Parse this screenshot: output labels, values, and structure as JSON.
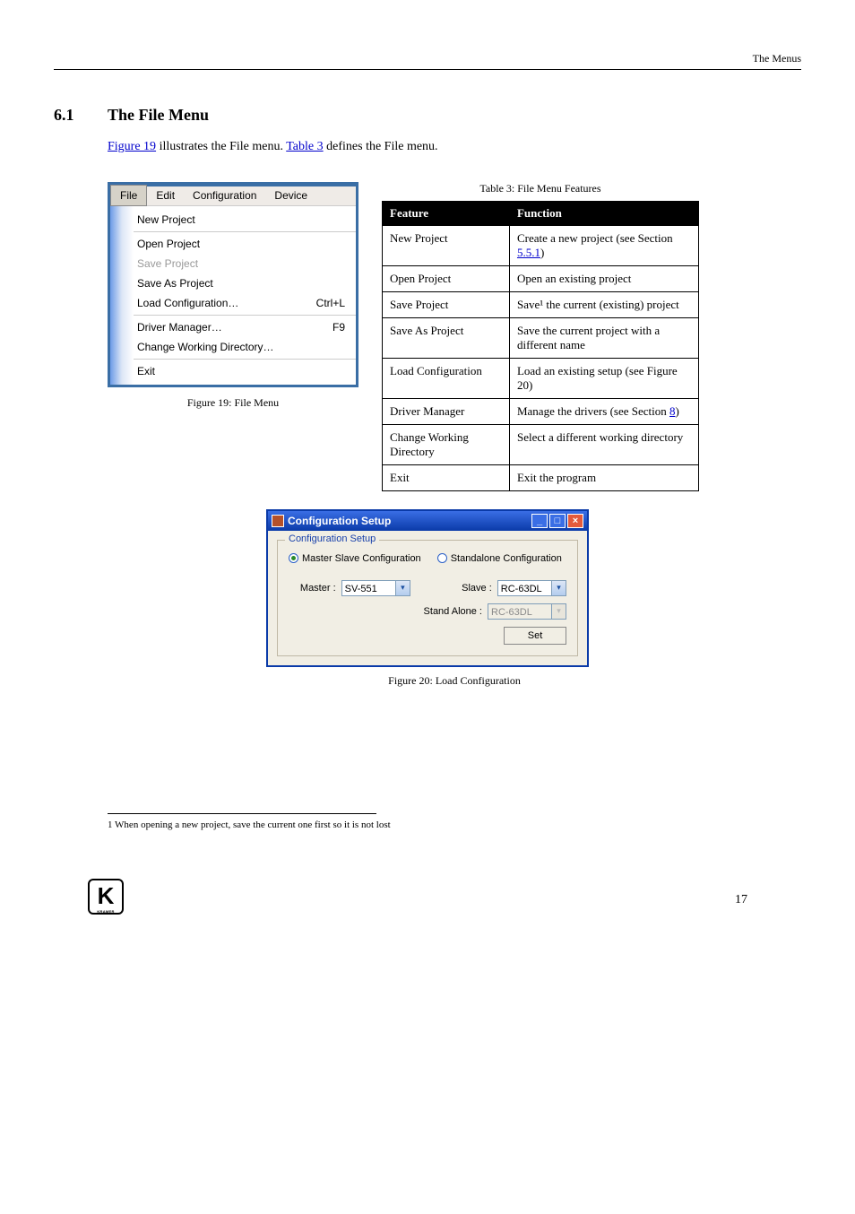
{
  "header": {
    "right": "The Menus"
  },
  "section": {
    "number": "6.1",
    "title": "The File Menu"
  },
  "para": {
    "link1": "Figure 19",
    "text1": " illustrates the File menu. ",
    "link2": "Table 3",
    "text2": " defines the File menu.",
    "caption_left": "Figure 19: File Menu",
    "caption_right": "Table 3: File Menu Features"
  },
  "filemenu": {
    "menubar": [
      "File",
      "Edit",
      "Configuration",
      "Device"
    ],
    "items": [
      {
        "label": "New Project",
        "shortcut": "",
        "disabled": false
      },
      {
        "label": "Open Project",
        "shortcut": "",
        "disabled": false
      },
      {
        "label": "Save Project",
        "shortcut": "",
        "disabled": true
      },
      {
        "label": "Save As Project",
        "shortcut": "",
        "disabled": false
      },
      {
        "label": "Load Configuration…",
        "shortcut": "Ctrl+L",
        "disabled": false
      },
      {
        "label": "Driver Manager…",
        "shortcut": "F9",
        "disabled": false
      },
      {
        "label": "Change Working Directory…",
        "shortcut": "",
        "disabled": false
      },
      {
        "label": "Exit",
        "shortcut": "",
        "disabled": false
      }
    ]
  },
  "table": {
    "head": [
      "Feature",
      "Function"
    ],
    "rows": [
      [
        "New Project",
        "Create a new project (see Section 5.5.1)",
        "5.5.1"
      ],
      [
        "Open Project",
        "Open an existing project",
        ""
      ],
      [
        "Save Project",
        "Save¹ the current (existing) project",
        ""
      ],
      [
        "Save As Project",
        "Save the current project with a different name",
        ""
      ],
      [
        "Load Configuration",
        "Load an existing setup (see Figure 20)",
        ""
      ],
      [
        "Driver Manager",
        "Manage the drivers (see Section 8)",
        "8"
      ],
      [
        "Change Working Directory",
        "Select a different working directory",
        ""
      ],
      [
        "Exit",
        "Exit the program",
        ""
      ]
    ]
  },
  "dialog": {
    "title": "Configuration Setup",
    "group": "Configuration Setup",
    "radio1": "Master Slave Configuration",
    "radio2": "Standalone Configuration",
    "master_label": "Master :",
    "master_value": "SV-551",
    "slave_label": "Slave :",
    "slave_value": "RC-63DL",
    "standalone_label": "Stand Alone :",
    "standalone_value": "RC-63DL",
    "set": "Set"
  },
  "fig20": "Figure 20: Load Configuration",
  "footnote": "1 When opening a new project, save the current one first so it is not lost",
  "pagenum": "17",
  "logo": "K",
  "logo_sub": "KRAMER"
}
